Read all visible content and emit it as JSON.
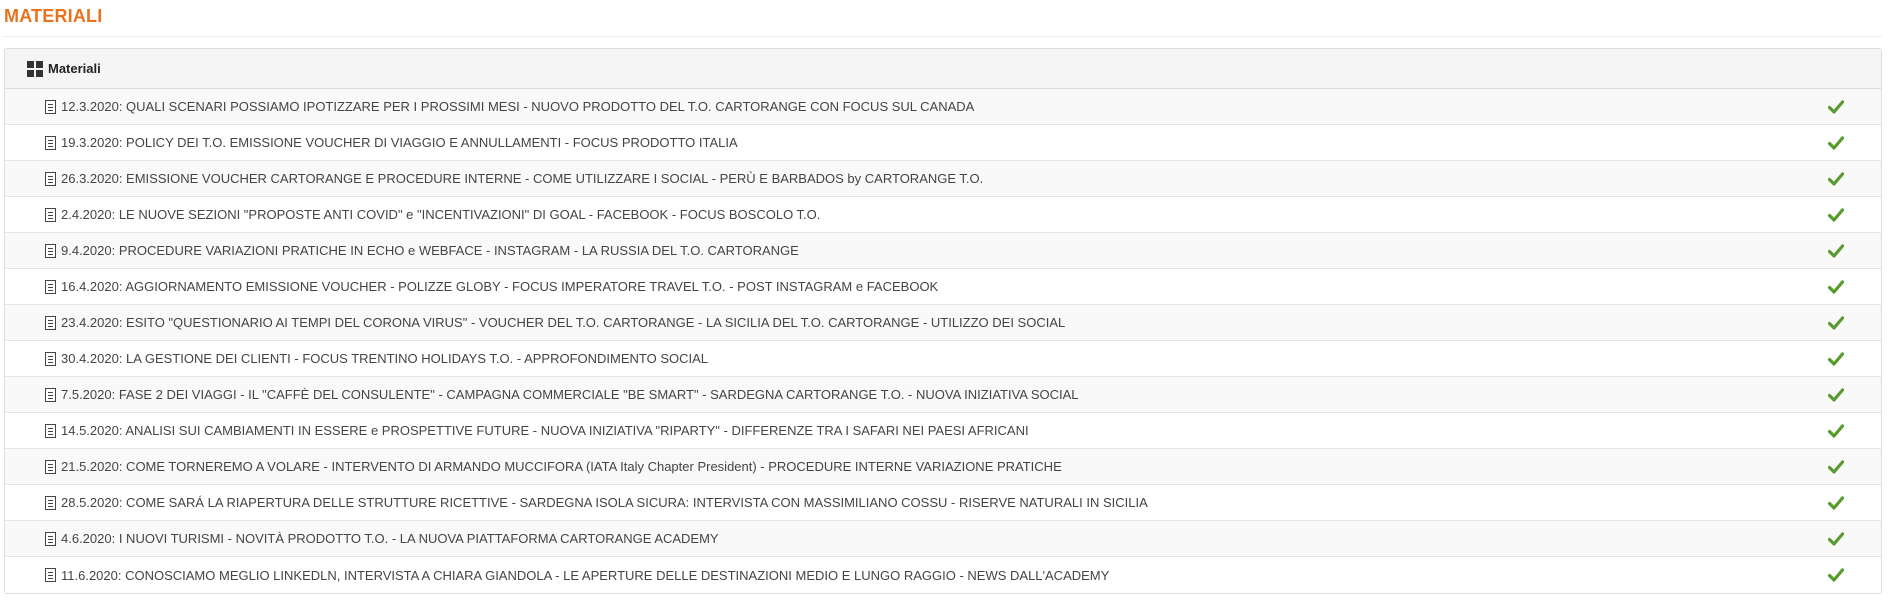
{
  "page_title": "MATERIALI",
  "panel": {
    "title": "Materiali",
    "header_icon": "grid-icon",
    "item_icon": "document-icon",
    "status_icon": "check-icon",
    "status_color": "#5a9a2e"
  },
  "colors": {
    "title": "#e8731f",
    "check": "#5a9a2e"
  },
  "items": [
    {
      "label": "12.3.2020: QUALI SCENARI POSSIAMO IPOTIZZARE PER I PROSSIMI MESI - NUOVO PRODOTTO DEL T.O. CARTORANGE CON FOCUS SUL CANADA",
      "completed": true
    },
    {
      "label": "19.3.2020: POLICY DEI T.O. EMISSIONE VOUCHER DI VIAGGIO E ANNULLAMENTI - FOCUS PRODOTTO ITALIA",
      "completed": true
    },
    {
      "label": "26.3.2020: EMISSIONE VOUCHER CARTORANGE E PROCEDURE INTERNE - COME UTILIZZARE I SOCIAL - PERÙ E BARBADOS by CARTORANGE T.O.",
      "completed": true
    },
    {
      "label": "2.4.2020: LE NUOVE SEZIONI \"PROPOSTE ANTI COVID\" e \"INCENTIVAZIONI\" DI GOAL - FACEBOOK - FOCUS BOSCOLO T.O.",
      "completed": true
    },
    {
      "label": "9.4.2020: PROCEDURE VARIAZIONI PRATICHE IN ECHO e WEBFACE - INSTAGRAM - LA RUSSIA DEL T.O. CARTORANGE",
      "completed": true
    },
    {
      "label": "16.4.2020: AGGIORNAMENTO EMISSIONE VOUCHER - POLIZZE GLOBY - FOCUS IMPERATORE TRAVEL T.O. - POST INSTAGRAM e FACEBOOK",
      "completed": true
    },
    {
      "label": "23.4.2020: ESITO \"QUESTIONARIO AI TEMPI DEL CORONA VIRUS\" - VOUCHER DEL T.O. CARTORANGE - LA SICILIA DEL T.O. CARTORANGE - UTILIZZO DEI SOCIAL",
      "completed": true
    },
    {
      "label": "30.4.2020: LA GESTIONE DEI CLIENTI - FOCUS TRENTINO HOLIDAYS T.O. - APPROFONDIMENTO SOCIAL",
      "completed": true
    },
    {
      "label": "7.5.2020: FASE 2 DEI VIAGGI - IL \"CAFFÈ DEL CONSULENTE\" - CAMPAGNA COMMERCIALE \"BE SMART\" - SARDEGNA CARTORANGE T.O. - NUOVA INIZIATIVA SOCIAL",
      "completed": true
    },
    {
      "label": "14.5.2020: ANALISI SUI CAMBIAMENTI IN ESSERE e PROSPETTIVE FUTURE - NUOVA INIZIATIVA \"RIPARTY\" - DIFFERENZE TRA I SAFARI NEI PAESI AFRICANI",
      "completed": true
    },
    {
      "label": "21.5.2020: COME TORNEREMO A VOLARE - INTERVENTO DI ARMANDO MUCCIFORA (IATA Italy Chapter President) - PROCEDURE INTERNE VARIAZIONE PRATICHE",
      "completed": true
    },
    {
      "label": "28.5.2020: COME SARÁ LA RIAPERTURA DELLE STRUTTURE RICETTIVE - SARDEGNA ISOLA SICURA: INTERVISTA CON MASSIMILIANO COSSU - RISERVE NATURALI IN SICILIA",
      "completed": true
    },
    {
      "label": "4.6.2020: I NUOVI TURISMI - NOVITÀ PRODOTTO T.O. - LA NUOVA PIATTAFORMA CARTORANGE ACADEMY",
      "completed": true
    },
    {
      "label": "11.6.2020: CONOSCIAMO MEGLIO LINKEDLN, INTERVISTA A CHIARA GIANDOLA - LE APERTURE DELLE DESTINAZIONI MEDIO E LUNGO RAGGIO - NEWS DALL'ACADEMY",
      "completed": true
    }
  ]
}
